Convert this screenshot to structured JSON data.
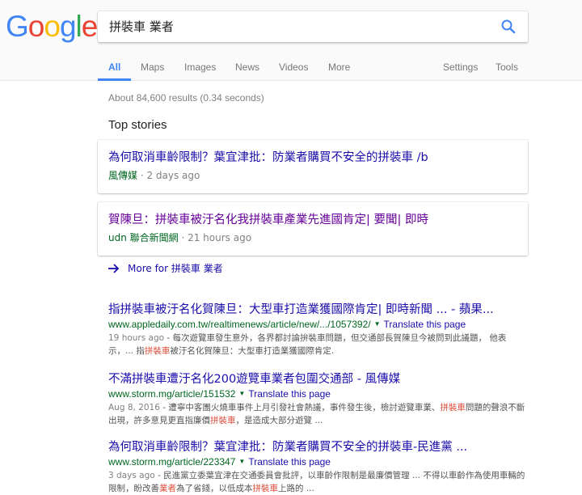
{
  "logo": {
    "letters": [
      "G",
      "o",
      "o",
      "g",
      "l",
      "e"
    ],
    "colors": [
      "#4285f4",
      "#ea4335",
      "#fbbc05",
      "#4285f4",
      "#34a853",
      "#ea4335"
    ]
  },
  "search": {
    "value": "拼裝車 業者"
  },
  "tabs": {
    "all": "All",
    "maps": "Maps",
    "images": "Images",
    "news": "News",
    "videos": "Videos",
    "more": "More",
    "settings": "Settings",
    "tools": "Tools"
  },
  "result_stats": "About 84,600 results (0.34 seconds)",
  "top_stories": {
    "heading": "Top stories",
    "cards": [
      {
        "title": "為何取消車齡限制？葉宜津批：防業者購買不安全的拼裝車 /b",
        "source": "風傳媒",
        "time": " · 2 days ago"
      },
      {
        "title": "賀陳旦：拼裝車被汙名化我拼裝車產業先進國肯定| 要聞| 即時",
        "source": "udn 聯合新聞網",
        "time": " · 21 hours ago"
      }
    ],
    "more_label": "More for 拼裝車 業者"
  },
  "results": [
    {
      "title": "指拼裝車被汙名化賀陳旦：大型車打造業獲國際肯定| 即時新聞 ... - 蘋果...",
      "url": "www.appledaily.com.tw/realtimenews/article/new/.../1057392/",
      "translate": "Translate this page",
      "date": "19 hours ago",
      "snippet_1": " - 每次遊覽車發生意外，各界都討論拚裝車問題，但交通部長賀陳旦今被問到此議題， 他表示，... 指",
      "snippet_hl": "拼裝車",
      "snippet_2": "被汙名化賀陳旦：大型車打造業獲國際肯定."
    },
    {
      "title": "不滿拼裝車遭汙名化200遊覽車業者包圍交通部 - 風傳媒",
      "url": "www.storm.mg/article/151532",
      "translate": "Translate this page",
      "date": "Aug 8, 2016",
      "snippet_1": " - 遭寧中客團火燒車事件上月引發社會熱議，事件發生後，檢討遊覽車業、",
      "snippet_hl": "拼裝車",
      "snippet_2": "問題的聲浪不斷出現，許多意見更直指廉價",
      "snippet_hl2": "拼裝車",
      "snippet_3": "，是造成大部分遊覽 ..."
    },
    {
      "title": "為何取消車齡限制？葉宜津批：防業者購買不安全的拼裝車-民進黨 ...",
      "url": "www.storm.mg/article/223347",
      "translate": "Translate this page",
      "date": "3 days ago",
      "snippet_1": " - 民進黨立委葉宜津在交通委員會批評，以車齡作限制是最廉價管理 ... 不得以車齡作為使用車輛的限制，盼改善",
      "snippet_hl": "業者",
      "snippet_2": "為了省錢，以低成本",
      "snippet_hl2": "拼裝車",
      "snippet_3": "上路的 ..."
    }
  ]
}
